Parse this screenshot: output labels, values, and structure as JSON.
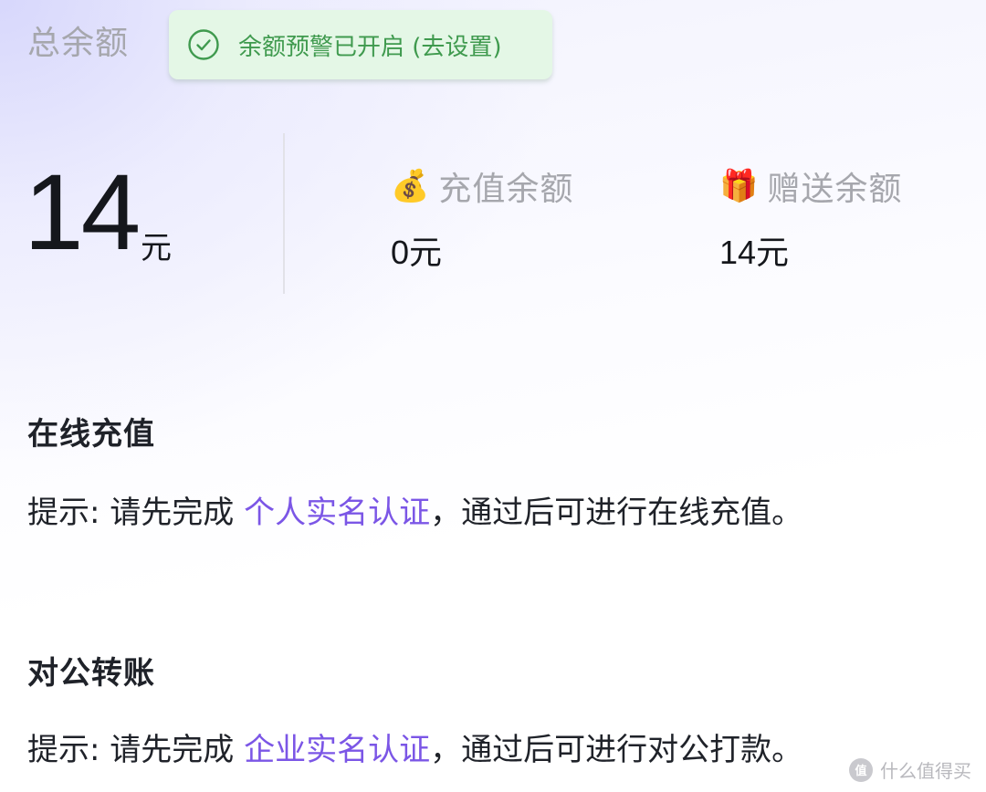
{
  "header": {
    "total_label": "总余额",
    "alert_text": "余额预警已开启 (去设置)",
    "alert_icon": "check-circle-icon",
    "alert_color": "#3f9a4e",
    "alert_bg": "#e4f7e6"
  },
  "balance": {
    "total_value": "14",
    "total_unit": "元",
    "recharge": {
      "icon": "money-bag-icon",
      "emoji": "💰",
      "label": "充值余额",
      "value": "0",
      "unit": "元"
    },
    "gift": {
      "icon": "gift-icon",
      "emoji": "🎁",
      "label": "赠送余额",
      "value": "14",
      "unit": "元"
    }
  },
  "online_recharge": {
    "title": "在线充值",
    "hint_prefix": "提示: 请先完成 ",
    "hint_link": "个人实名认证",
    "hint_suffix": "，通过后可进行在线充值。"
  },
  "corporate_transfer": {
    "title": "对公转账",
    "hint_prefix": "提示: 请先完成 ",
    "hint_link": "企业实名认证",
    "hint_suffix": "，通过后可进行对公打款。"
  },
  "theme": {
    "link_color": "#7b56e6",
    "text_color": "#1f2229",
    "muted_color": "#a6a7ad"
  },
  "watermark": {
    "logo_text": "值",
    "text": "什么值得买"
  }
}
